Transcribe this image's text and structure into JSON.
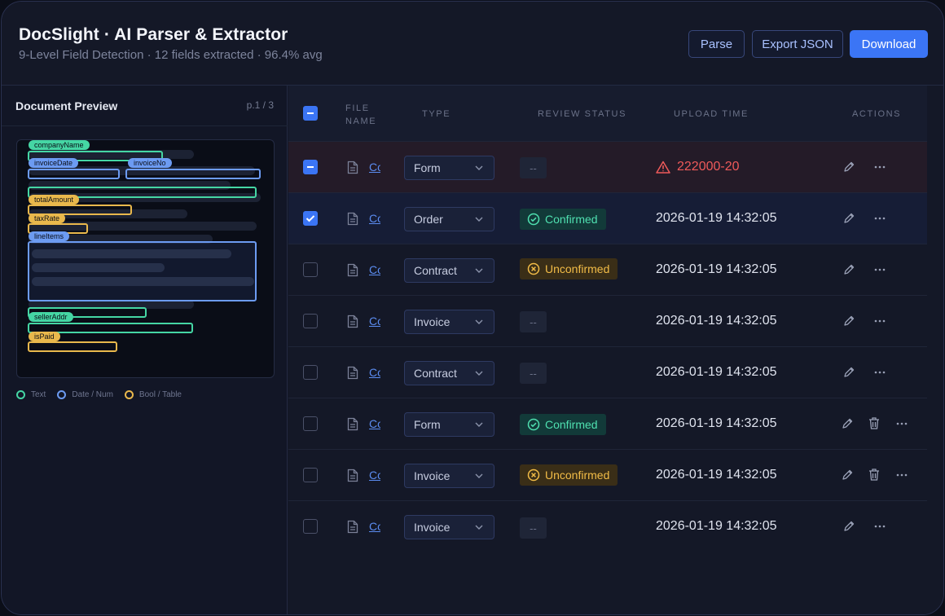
{
  "header": {
    "title": "DocSlight · AI Parser & Extractor",
    "subtitle": "9-Level Field Detection · 12 fields extracted · 96.4% avg",
    "buttons": {
      "parse": "Parse",
      "export": "Export JSON",
      "download": "Download"
    }
  },
  "preview": {
    "title": "Document Preview",
    "page": "p.1 / 3",
    "tags": {
      "companyName": "companyName",
      "invoiceDate": "invoiceDate",
      "invoiceNo": "invoiceNo",
      "totalAmount": "totalAmount",
      "taxRate": "taxRate",
      "lineItems": "lineItems",
      "sellerAddr": "sellerAddr",
      "isPaid": "isPaid"
    },
    "legend": {
      "text": "Text",
      "num": "Date / Num",
      "bool": "Bool / Table"
    },
    "colors": {
      "text": "#45d6a4",
      "num": "#6c9bf2",
      "bool": "#e9b84c"
    }
  },
  "table": {
    "columns": {
      "file": "File Name",
      "type": "Type",
      "status": "Review Status",
      "upload": "Upload Time",
      "actions": "Actions"
    },
    "rows": [
      {
        "file": "Co",
        "type": "Form",
        "status": "--",
        "upload": "222000-20"
      },
      {
        "file": "Co",
        "type": "Order",
        "status": "Confirmed",
        "upload": "2026-01-19 14:32:05"
      },
      {
        "file": "Co",
        "type": "Contract",
        "status": "Unconfirmed",
        "upload": "2026-01-19 14:32:05"
      },
      {
        "file": "Co",
        "type": "Invoice",
        "status": "--",
        "upload": "2026-01-19 14:32:05"
      },
      {
        "file": "Co",
        "type": "Contract",
        "status": "--",
        "upload": "2026-01-19 14:32:05"
      },
      {
        "file": "Co",
        "type": "Form",
        "status": "Confirmed",
        "upload": "2026-01-19 14:32:05"
      },
      {
        "file": "Co",
        "type": "Invoice",
        "status": "Unconfirmed",
        "upload": "2026-01-19 14:32:05"
      },
      {
        "file": "Co",
        "type": "Invoice",
        "status": "--",
        "upload": "2026-01-19 14:32:05"
      }
    ]
  },
  "colors": {
    "accent": "#3b75f5",
    "confirmed": "#4fe0b0",
    "unconfirmed": "#f2bc47",
    "error": "#ef5a5a"
  }
}
